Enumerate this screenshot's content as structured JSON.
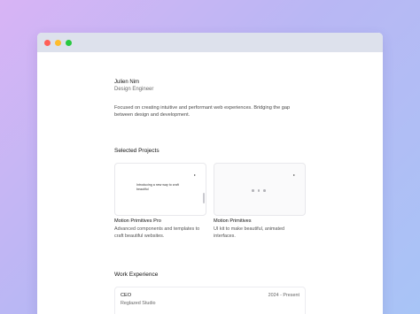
{
  "window": {
    "controls": [
      "close-dot",
      "minimize-dot",
      "maximize-dot"
    ]
  },
  "profile": {
    "name": "Julien Nim",
    "role": "Design Engineer",
    "bio": "Focused on creating intuitive and performant web experiences. Bridging the gap between design and development."
  },
  "projects": {
    "title": "Selected Projects",
    "items": [
      {
        "name": "Motion Primitives Pro",
        "description": "Advanced components and templates to craft beautiful websites.",
        "thumb_caption": "Introducing a new way to craft beautiful"
      },
      {
        "name": "Motion Primitives",
        "description": "UI kit to make beautiful, animated interfaces."
      }
    ]
  },
  "work": {
    "title": "Work Experience",
    "items": [
      {
        "title": "CEO",
        "company": "Reglazed Studio",
        "dates": "2024 - Present"
      }
    ]
  }
}
